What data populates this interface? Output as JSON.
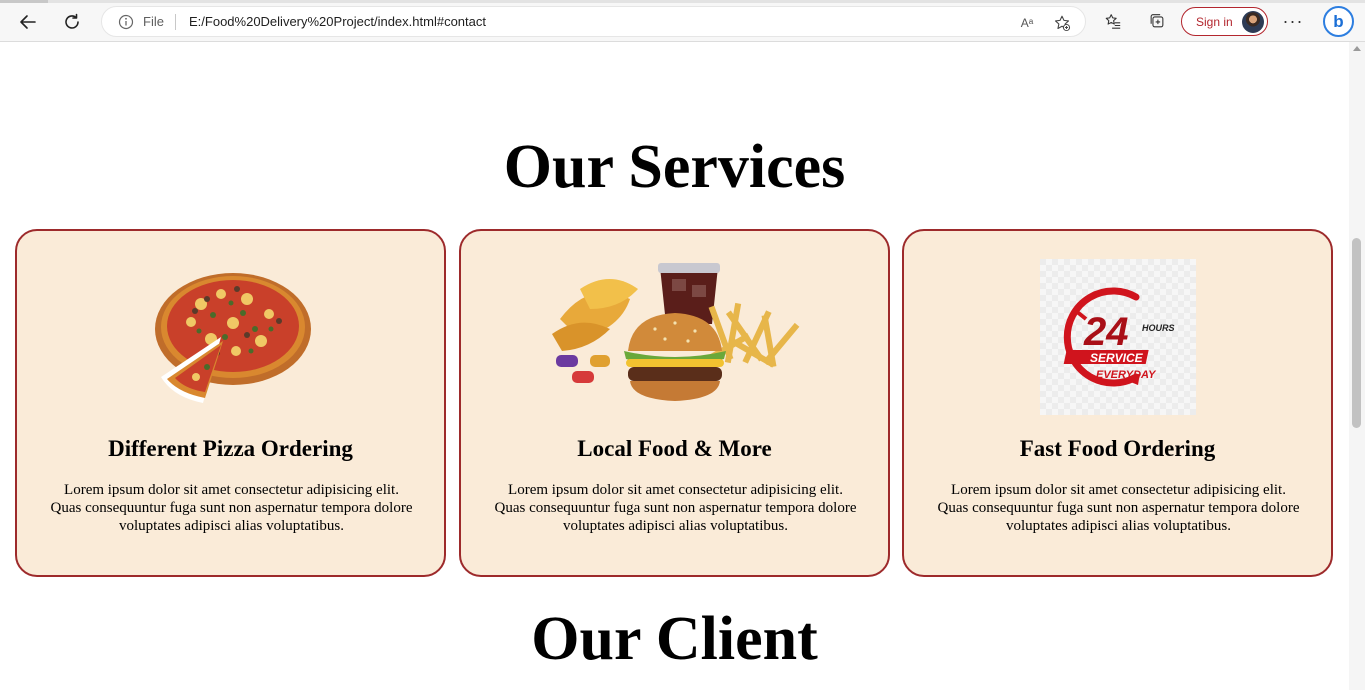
{
  "browser": {
    "address_file_label": "File",
    "url": "E:/Food%20Delivery%20Project/index.html#contact",
    "signin_label": "Sign in",
    "more_label": "···",
    "bing_label": "b",
    "read_aloud_label": "Aᵃ"
  },
  "page": {
    "services_title": "Our Services",
    "client_title": "Our Client",
    "services": [
      {
        "title": "Different Pizza Ordering",
        "text": "Lorem ipsum dolor sit amet consectetur adipisicing elit. Quas consequuntur fuga sunt non aspernatur tempora dolore voluptates adipisci alias voluptatibus.",
        "image": "pizza-image"
      },
      {
        "title": "Local Food & More",
        "text": "Lorem ipsum dolor sit amet consectetur adipisicing elit. Quas consequuntur fuga sunt non aspernatur tempora dolore voluptates adipisci alias voluptatibus.",
        "image": "burger-fries-image"
      },
      {
        "title": "Fast Food Ordering",
        "text": "Lorem ipsum dolor sit amet consectetur adipisicing elit. Quas consequuntur fuga sunt non aspernatur tempora dolore voluptates adipisci alias voluptatibus.",
        "image": "24-hours-service-image"
      }
    ],
    "badge": {
      "number": "24",
      "hours": "HOURS",
      "service": "SERVICE",
      "everyday": "EVERYDAY"
    }
  },
  "colors": {
    "card_background": "#faebd8",
    "card_border": "#9d2a2b",
    "signin_accent": "#b3262e",
    "badge_red": "#d0141d"
  }
}
